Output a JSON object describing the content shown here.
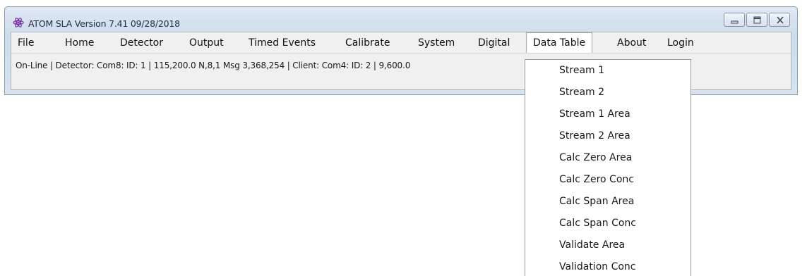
{
  "window": {
    "title": "ATOM SLA  Version 7.41  09/28/2018",
    "app_icon": "atom-icon",
    "controls": {
      "minimize_icon": "minimize-icon",
      "maximize_icon": "maximize-icon",
      "close_icon": "close-icon"
    }
  },
  "menu": {
    "items": [
      {
        "label": "File"
      },
      {
        "label": "Home"
      },
      {
        "label": "Detector"
      },
      {
        "label": "Output"
      },
      {
        "label": "Timed Events"
      },
      {
        "label": "Calibrate"
      },
      {
        "label": "System"
      },
      {
        "label": "Digital"
      },
      {
        "label": "Data Table",
        "active": true
      },
      {
        "label": "About"
      },
      {
        "label": "Login"
      }
    ]
  },
  "status": {
    "text": "On-Line |  Detector: Com8: ID: 1 | 115,200.0 N,8,1 Msg  3,368,254   | Client: Com4: ID: 2 | 9,600.0"
  },
  "dropdown": {
    "items": [
      {
        "label": "Stream 1"
      },
      {
        "label": "Stream 2"
      },
      {
        "label": "Stream 1 Area"
      },
      {
        "label": "Stream 2 Area"
      },
      {
        "label": "Calc Zero Area"
      },
      {
        "label": "Calc Zero Conc"
      },
      {
        "label": "Calc Span Area"
      },
      {
        "label": "Calc Span Conc"
      },
      {
        "label": "Validate Area"
      },
      {
        "label": "Validation Conc"
      }
    ]
  },
  "colors": {
    "frame": "#d8e3ef",
    "menu_bg": "#f0f0f0",
    "dropdown_bg": "#ffffff",
    "icon_purple": "#7b2fa6"
  }
}
